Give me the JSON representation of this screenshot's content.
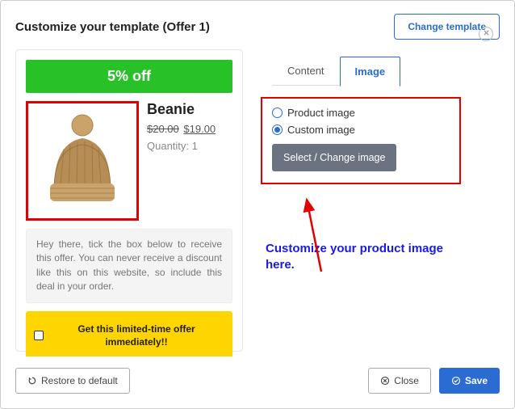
{
  "header": {
    "title": "Customize your template (Offer 1)",
    "change_template": "Change template"
  },
  "preview": {
    "discount": "5% off",
    "product_title": "Beanie",
    "price_old": "$20.00",
    "price_new": "$19.00",
    "quantity": "Quantity: 1",
    "description": "Hey there, tick the box below to receive this offer. You can never receive a discount like this on this website, so include this deal in your order.",
    "cta": "Get this limited-time offer immediately!!"
  },
  "tabs": {
    "content": "Content",
    "image": "Image"
  },
  "options": {
    "product_image": "Product image",
    "custom_image": "Custom image",
    "select_change": "Select / Change image"
  },
  "annotation": "Customize your product image here.",
  "footer": {
    "restore": "Restore to default",
    "close": "Close",
    "save": "Save"
  },
  "icons": {
    "close_x": "close",
    "restore": "restore",
    "close_btn": "cancel",
    "save": "check"
  }
}
